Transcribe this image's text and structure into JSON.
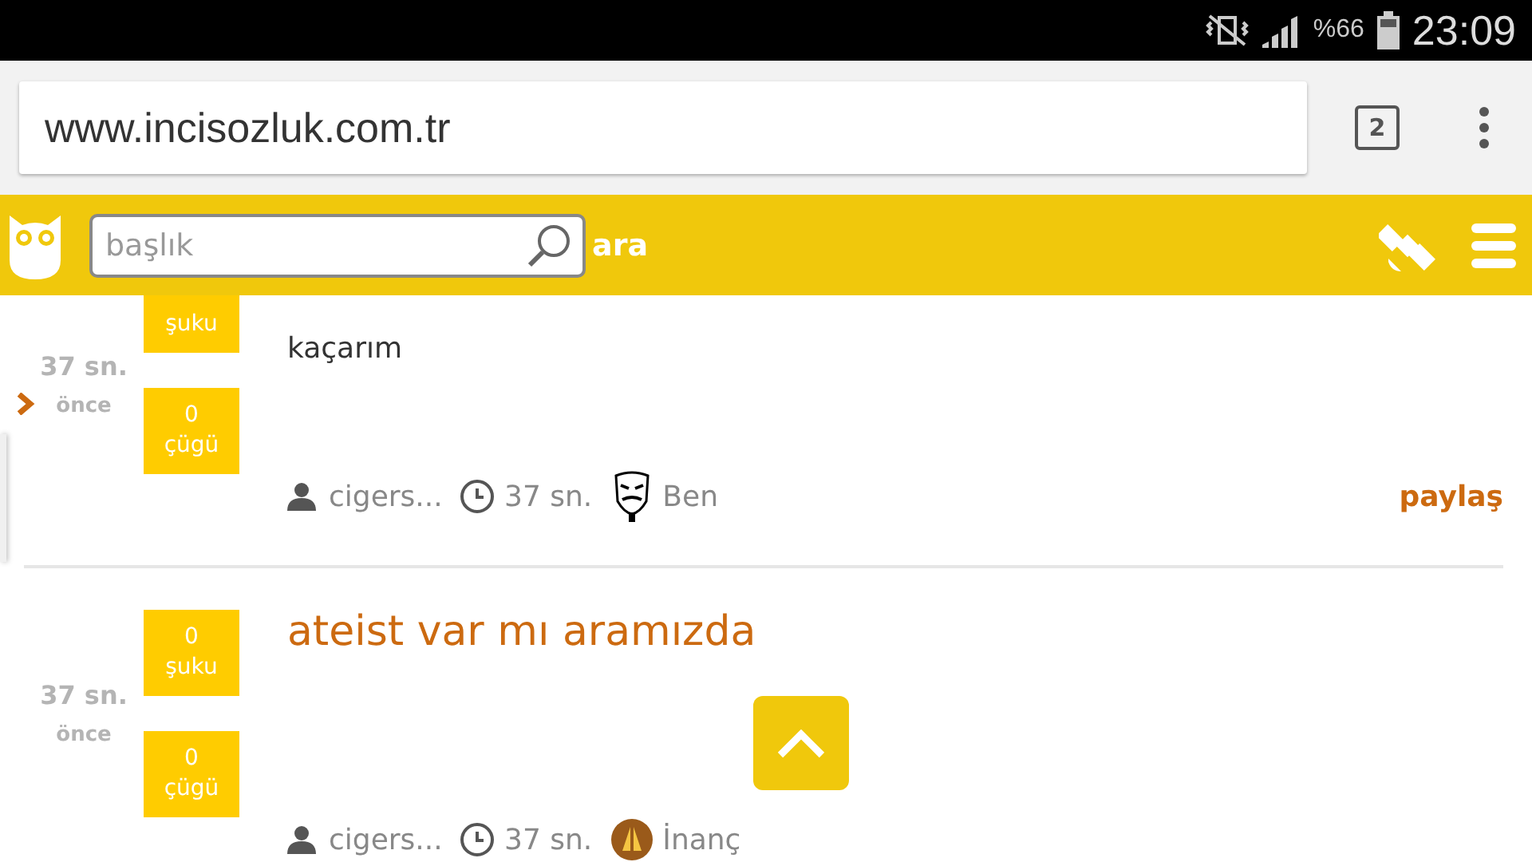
{
  "status_bar": {
    "battery": "%66",
    "time": "23:09"
  },
  "browser": {
    "url": "www.incisozluk.com.tr",
    "tab_count": "2"
  },
  "header": {
    "search_placeholder": "başlık",
    "search_label": "ara"
  },
  "posts": [
    {
      "time": "37 sn.",
      "time_suffix": "önce",
      "up_label": "şuku",
      "down_count": "0",
      "down_label": "çügü",
      "body": "kaçarım",
      "author": "cigers...",
      "posted": "37 sn.",
      "badge": {
        "kind": "mask",
        "label": "Ben"
      },
      "share": "paylaş"
    },
    {
      "time": "37 sn.",
      "time_suffix": "önce",
      "up_count": "0",
      "up_label": "şuku",
      "down_count": "0",
      "down_label": "çügü",
      "title": "ateist var mı aramızda",
      "author": "cigers...",
      "posted": "37 sn.",
      "badge": {
        "kind": "hands",
        "label": "İnanç"
      }
    }
  ]
}
